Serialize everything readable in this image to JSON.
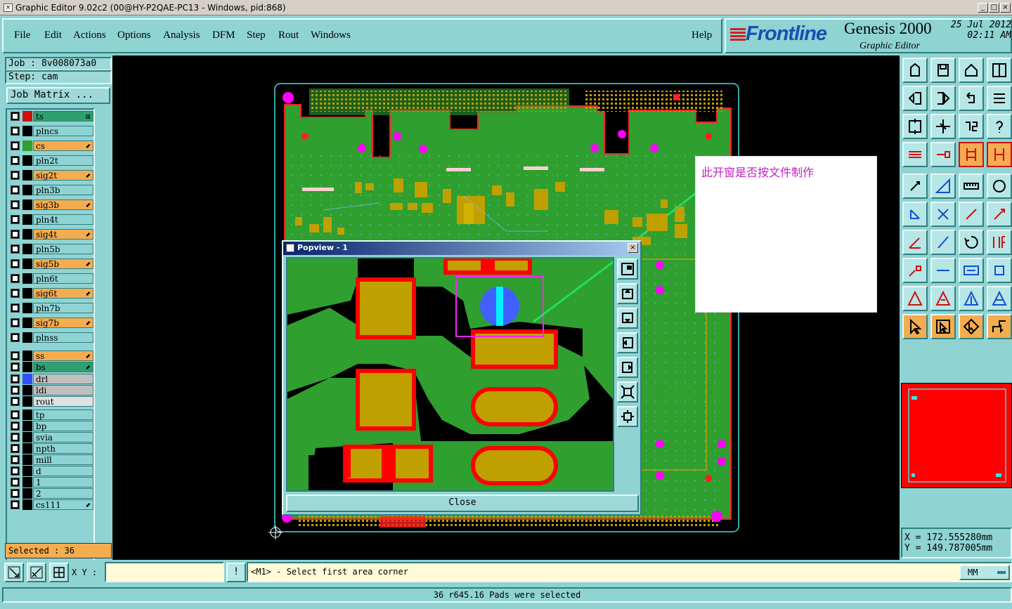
{
  "window": {
    "title": "Graphic Editor 9.02c2 (00@HY-P2QAE-PC13 - Windows, pid:868)",
    "controls": [
      "_",
      "□",
      "×"
    ]
  },
  "menu": {
    "items": [
      "File",
      "Edit",
      "Actions",
      "Options",
      "Analysis",
      "DFM",
      "Step",
      "Rout",
      "Windows"
    ],
    "help": "Help"
  },
  "brand": {
    "logo": "Frontline",
    "product": "Genesis 2000",
    "subtitle": "Graphic Editor",
    "date": "25 Jul 2012",
    "time": "02:11 AM"
  },
  "job": {
    "job_label": "Job : 8v008073a0",
    "step_label": "Step: cam",
    "matrix_button": "Job Matrix ..."
  },
  "layers": [
    {
      "name": "ts",
      "color": "#2f9f6f",
      "swatch": "#d01010",
      "tail": "⊞",
      "group": 1
    },
    {
      "name": "plncs",
      "color": "#8fd3d3",
      "swatch": "#000000",
      "tail": "",
      "group": 1
    },
    {
      "name": "cs",
      "color": "#f4ac50",
      "swatch": "#2f9f2f",
      "tail": "⬋",
      "group": 1
    },
    {
      "name": "pln2t",
      "color": "#8fd3d3",
      "swatch": "#000000",
      "tail": "",
      "group": 1
    },
    {
      "name": "sig2t",
      "color": "#f4ac50",
      "swatch": "#000000",
      "tail": "⬋",
      "group": 1
    },
    {
      "name": "pln3b",
      "color": "#8fd3d3",
      "swatch": "#000000",
      "tail": "",
      "group": 1
    },
    {
      "name": "sig3b",
      "color": "#f4ac50",
      "swatch": "#000000",
      "tail": "⬋",
      "group": 1
    },
    {
      "name": "pln4t",
      "color": "#8fd3d3",
      "swatch": "#000000",
      "tail": "",
      "group": 1
    },
    {
      "name": "sig4t",
      "color": "#f4ac50",
      "swatch": "#000000",
      "tail": "⬋",
      "group": 1
    },
    {
      "name": "pln5b",
      "color": "#8fd3d3",
      "swatch": "#000000",
      "tail": "",
      "group": 1
    },
    {
      "name": "sig5b",
      "color": "#f4ac50",
      "swatch": "#000000",
      "tail": "⬋",
      "group": 1
    },
    {
      "name": "pln6t",
      "color": "#8fd3d3",
      "swatch": "#000000",
      "tail": "",
      "group": 1
    },
    {
      "name": "sig6t",
      "color": "#f4ac50",
      "swatch": "#000000",
      "tail": "⬋",
      "group": 1
    },
    {
      "name": "pln7b",
      "color": "#8fd3d3",
      "swatch": "#000000",
      "tail": "",
      "group": 1
    },
    {
      "name": "sig7b",
      "color": "#f4ac50",
      "swatch": "#000000",
      "tail": "⬋",
      "group": 1
    },
    {
      "name": "plnss",
      "color": "#8fd3d3",
      "swatch": "#000000",
      "tail": "",
      "group": 1
    },
    {
      "name": "ss",
      "color": "#f4ac50",
      "swatch": "#000000",
      "tail": "⬋",
      "group": 2
    },
    {
      "name": "bs",
      "color": "#2f9f6f",
      "swatch": "#000000",
      "tail": "⬋",
      "group": 2
    },
    {
      "name": "drl",
      "color": "#c0c0c0",
      "swatch": "#3050ff",
      "tail": "",
      "group": 3
    },
    {
      "name": "ldi",
      "color": "#c0c0c0",
      "swatch": "#000000",
      "tail": "",
      "group": 3
    },
    {
      "name": "rout",
      "color": "#e0e0e0",
      "swatch": "#000000",
      "tail": "",
      "group": 3
    },
    {
      "name": "tp",
      "color": "#8fd3d3",
      "swatch": "#000000",
      "tail": "",
      "group": 4
    },
    {
      "name": "bp",
      "color": "#8fd3d3",
      "swatch": "#000000",
      "tail": "",
      "group": 4
    },
    {
      "name": "svia",
      "color": "#8fd3d3",
      "swatch": "#000000",
      "tail": "",
      "group": 4
    },
    {
      "name": "npth",
      "color": "#8fd3d3",
      "swatch": "#000000",
      "tail": "",
      "group": 4
    },
    {
      "name": "mill",
      "color": "#8fd3d3",
      "swatch": "#000000",
      "tail": "",
      "group": 4
    },
    {
      "name": "d",
      "color": "#8fd3d3",
      "swatch": "#000000",
      "tail": "",
      "group": 4
    },
    {
      "name": "1",
      "color": "#8fd3d3",
      "swatch": "#000000",
      "tail": "",
      "group": 4
    },
    {
      "name": "2",
      "color": "#8fd3d3",
      "swatch": "#000000",
      "tail": "",
      "group": 4
    },
    {
      "name": "cs111",
      "color": "#8fd3d3",
      "swatch": "#000000",
      "tail": "⬋",
      "group": 4
    }
  ],
  "selected": "Selected : 36",
  "popview": {
    "title": "Popview - 1",
    "close_button": "Close"
  },
  "note": {
    "text": "此开窗是否按文件制作"
  },
  "coords": {
    "x": "X  =  172.555280mm",
    "y": "Y  =  149.787005mm"
  },
  "bottom": {
    "xy_label": "X Y :",
    "xy_value": "",
    "bang": "!",
    "prompt": "<M1> - Select first area corner",
    "units": "MM"
  },
  "status": "36 r645.16 Pads were selected",
  "colors": {
    "board": "#2f9f2f",
    "pad": "#c0a000",
    "outline": "#ff0000",
    "via": "#ff00ff",
    "panel": "#8fd3d3",
    "highlight": "#f4ac50"
  }
}
